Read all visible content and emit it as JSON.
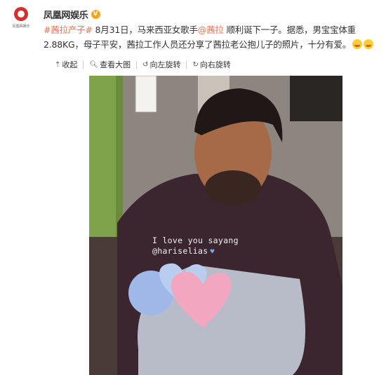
{
  "account": {
    "name": "凤凰网娱乐",
    "avatar_caption": "凤凰网娱乐",
    "verified_badge": "V"
  },
  "post": {
    "hashtag": "#茜拉产子#",
    "text_before_mention": " 8月31日，马来西亚女歌手",
    "mention": "@茜拉",
    "text_after_mention": " 顺利诞下一子。据悉，男宝宝体重2.88KG，母子平安，茜拉工作人员还分享了茜拉老公抱儿子的照片，十分有爱。"
  },
  "toolbar": {
    "collapse_label": "收起",
    "view_large_label": "查看大图",
    "rotate_left_label": "向左旋转",
    "rotate_right_label": "向右旋转"
  },
  "photo": {
    "caption_line1": "I love you sayang",
    "caption_line2": "@hariselias"
  },
  "icons": {
    "collapse": "up-arrow-icon",
    "view_large": "search-icon",
    "rotate_left": "rotate-left-icon",
    "rotate_right": "rotate-right-icon",
    "emoji": "emoji-icon",
    "heart": "heart-icon"
  },
  "colors": {
    "accent_link": "#eb7350",
    "verified": "#f4a623",
    "brand_red": "#d42e2e"
  }
}
